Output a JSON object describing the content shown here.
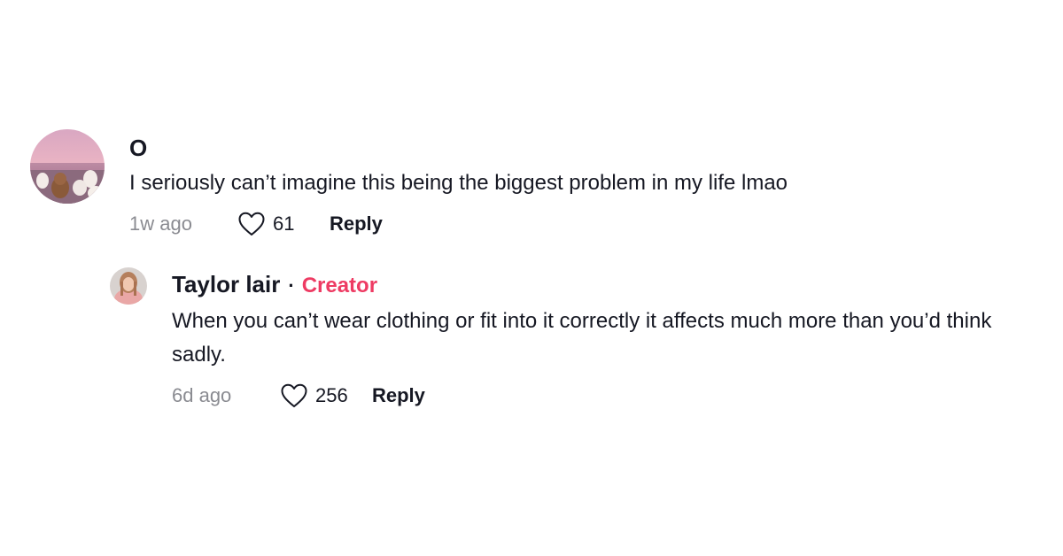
{
  "comments": [
    {
      "username": "O",
      "text": "I seriously can’t imagine this being the biggest problem in my life lmao",
      "time": "1w ago",
      "likes": "61",
      "reply_label": "Reply",
      "replies": [
        {
          "username": "Taylor lair",
          "separator": "·",
          "badge": "Creator",
          "text": "When you can’t wear clothing or fit into it correctly it affects much more than you’d think sadly.",
          "time": "6d ago",
          "likes": "256",
          "reply_label": "Reply"
        }
      ]
    }
  ],
  "colors": {
    "creator_badge": "#ee3b63",
    "primary_text": "#161823",
    "secondary_text": "#8a8b91"
  },
  "icons": {
    "like": "heart-outline-icon"
  }
}
